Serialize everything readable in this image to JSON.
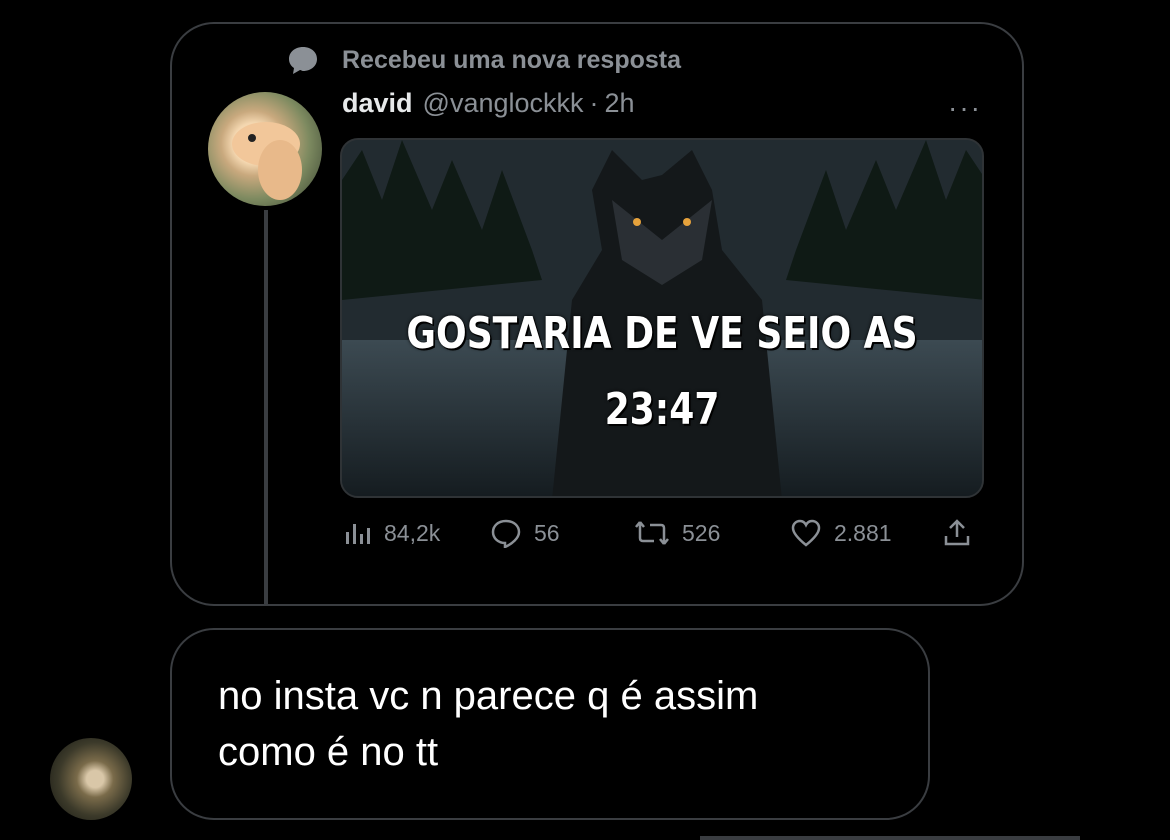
{
  "notification": {
    "text": "Recebeu uma nova resposta",
    "icon": "speech-bubble-icon"
  },
  "tweet": {
    "name": "david",
    "handle": "@vanglockkk",
    "separator": "·",
    "time": "2h",
    "more": "···",
    "media": {
      "caption_line1": "GOSTARIA DE VE SEIO AS",
      "caption_line2": "23:47"
    },
    "actions": {
      "views": {
        "icon": "views-bar-chart-icon",
        "count": "84,2k"
      },
      "replies": {
        "icon": "reply-bubble-icon",
        "count": "56"
      },
      "retweets": {
        "icon": "retweet-icon",
        "count": "526"
      },
      "likes": {
        "icon": "heart-icon",
        "count": "2.881"
      },
      "share": {
        "icon": "share-icon"
      }
    }
  },
  "reply": {
    "line1": "no insta vc n parece q é assim",
    "line2": "como é no tt"
  },
  "colors": {
    "background": "#000000",
    "muted": "#8b9096",
    "border": "#3a3d41"
  }
}
